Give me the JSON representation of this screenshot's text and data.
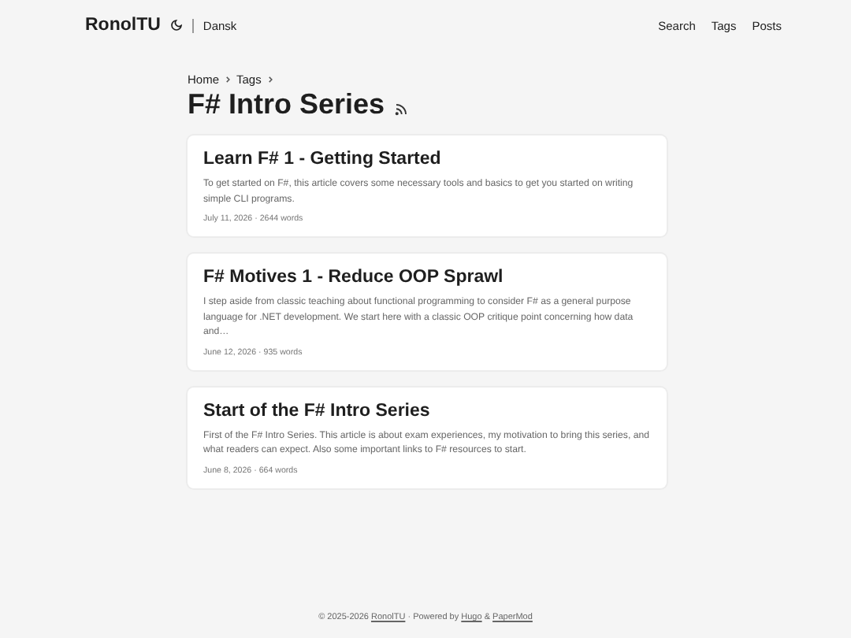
{
  "header": {
    "logo": "RonolTU",
    "language": "Dansk",
    "menu": [
      "Search",
      "Tags",
      "Posts"
    ]
  },
  "breadcrumbs": [
    "Home",
    "Tags"
  ],
  "title": "F# Intro Series",
  "posts": [
    {
      "title": "Learn F# 1 - Getting Started",
      "summary": "To get started on F#, this article covers some necessary tools and basics to get you started on writing simple CLI programs.",
      "meta": "July 11, 2026 · 2644 words"
    },
    {
      "title": "F# Motives 1 - Reduce OOP Sprawl",
      "summary": "I step aside from classic teaching about functional programming to consider F# as a general purpose language for .NET development. We start here with a classic OOP critique point concerning how data and…",
      "meta": "June 12, 2026 · 935 words"
    },
    {
      "title": "Start of the F# Intro Series",
      "summary": "First of the F# Intro Series. This article is about exam experiences, my motivation to bring this series, and what readers can expect. Also some important links to F# resources to start.",
      "meta": "June 8, 2026 · 664 words"
    }
  ],
  "footer": {
    "copyright": "© 2025-2026",
    "site_link": "RonolTU",
    "powered": "· Powered by",
    "hugo_link": "Hugo",
    "and": "&",
    "theme_link": "PaperMod"
  }
}
